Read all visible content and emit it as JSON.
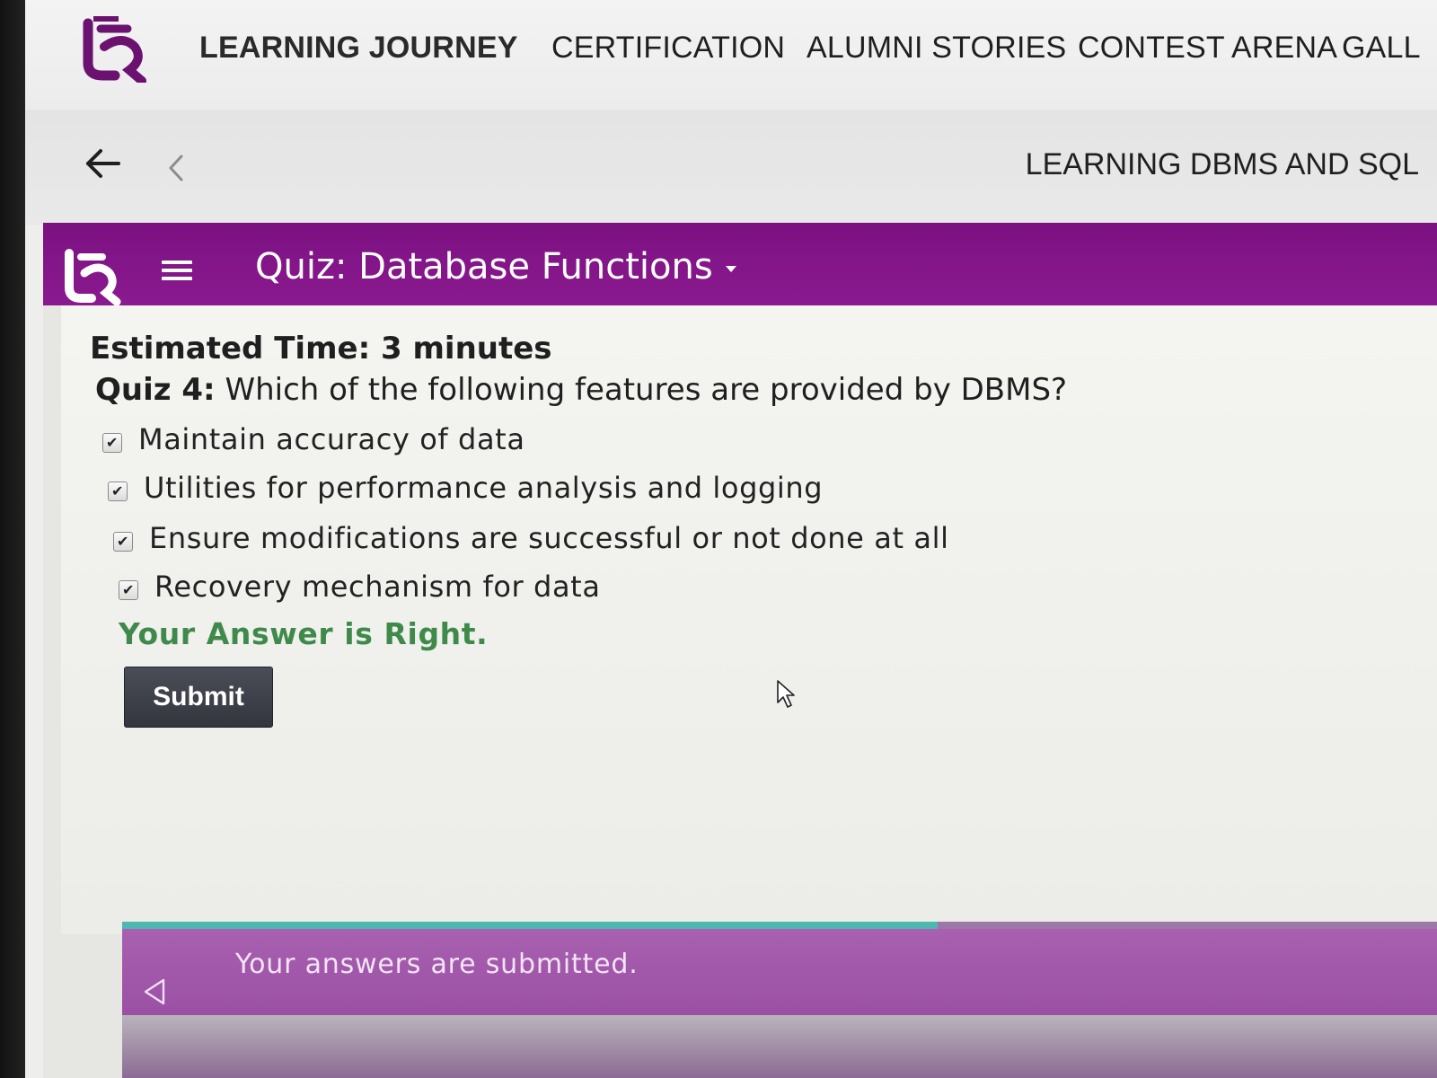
{
  "nav": {
    "items": [
      {
        "label": "LEARNING JOURNEY"
      },
      {
        "label": "CERTIFICATION"
      },
      {
        "label": "ALUMNI STORIES"
      },
      {
        "label": "CONTEST ARENA"
      },
      {
        "label": "GALL"
      }
    ]
  },
  "subbar": {
    "course_title": "LEARNING DBMS AND SQL"
  },
  "quizbar": {
    "title": "Quiz: Database Functions"
  },
  "quiz": {
    "estimated_time": "Estimated Time: 3 minutes",
    "question_label": "Quiz 4:",
    "question_text": " Which of the following features are provided by DBMS?",
    "options": [
      {
        "label": "Maintain accuracy of data",
        "checked": true
      },
      {
        "label": "Utilities for performance analysis and logging",
        "checked": true
      },
      {
        "label": "Ensure modifications are successful or not done at all",
        "checked": true
      },
      {
        "label": "Recovery mechanism for data",
        "checked": true
      }
    ],
    "result": "Your Answer is Right.",
    "submit_label": "Submit"
  },
  "notice": {
    "text": "Your answers are submitted.",
    "progress_fraction": 0.62
  },
  "colors": {
    "brand_purple": "#7c1182",
    "success_green": "#3f8a4a",
    "notice_purple": "#a860b0",
    "progress_teal": "#4cb8b0"
  },
  "icons": {
    "logo": "brand-logo",
    "back": "back-arrow-icon",
    "prev": "chevron-left-icon",
    "menu": "hamburger-menu-icon",
    "dropdown": "caret-down-icon",
    "checkbox": "checkmark-icon",
    "cursor": "mouse-pointer-icon",
    "notice_back": "triangle-left-icon"
  }
}
